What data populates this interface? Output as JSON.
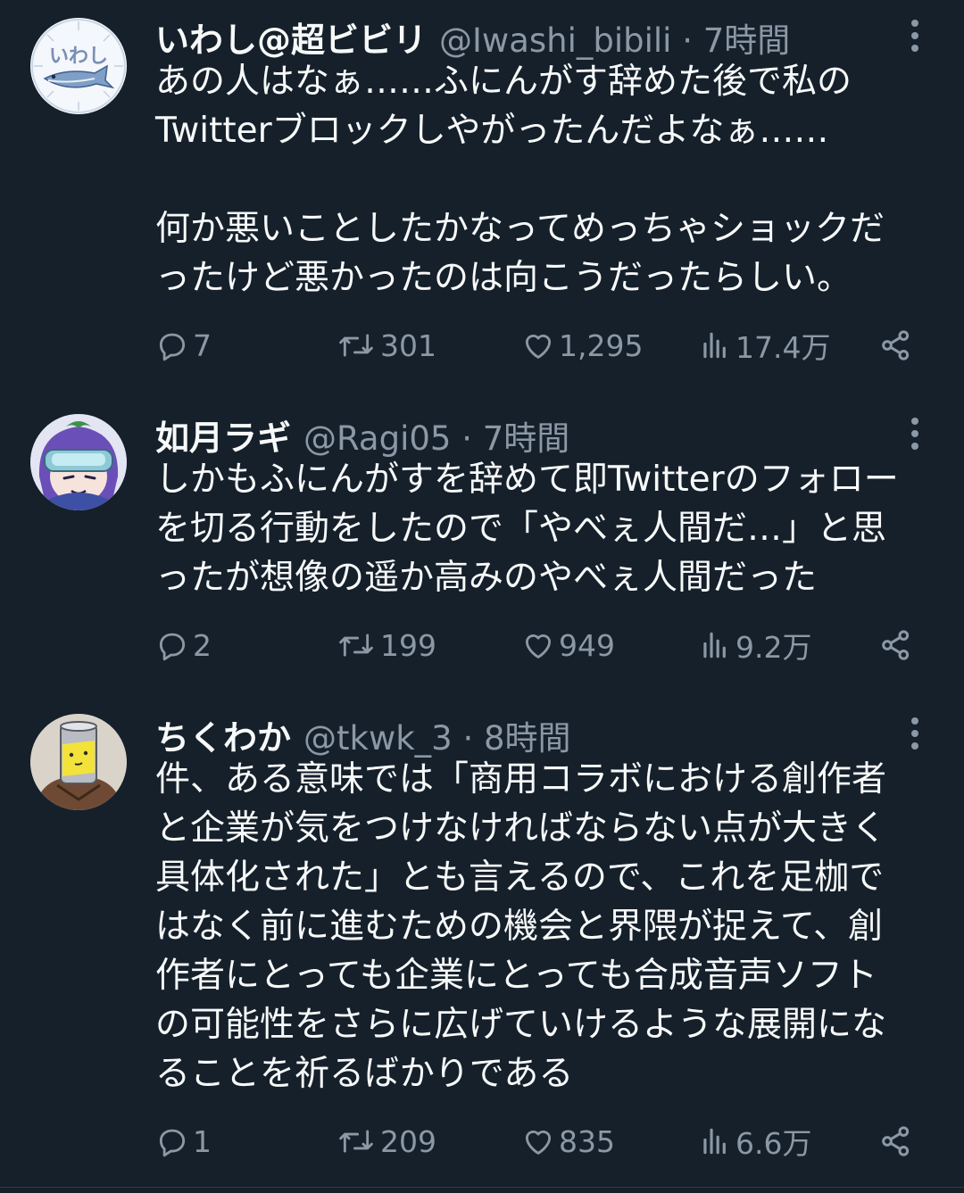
{
  "colors": {
    "background": "#15202b",
    "text_primary": "#f7f9f9",
    "text_secondary": "#8b98a5"
  },
  "tweets": [
    {
      "display_name": "いわし@超ビビリ",
      "meta": "@Iwashi_bibili · 7時間",
      "avatar_text": "いわし",
      "avatar_icon": "sardine-fish-icon",
      "body": "あの人はなぁ……ふにんがす辞めた後で私の\nTwitterブロックしやがったんだよなぁ……\n\n何か悪いことしたかなってめっちゃショックだ\nったけど悪かったのは向こうだったらしい。",
      "replies": "7",
      "retweets": "301",
      "likes": "1,295",
      "views": "17.4万"
    },
    {
      "display_name": "如月ラギ",
      "meta": "@Ragi05 · 7時間",
      "avatar_icon": "anime-character-avatar-icon",
      "body": "しかもふにんがすを辞めて即Twitterのフォロー\nを切る行動をしたので「やべぇ人間だ…」と思\nったが想像の遥か高みのやべぇ人間だった",
      "replies": "2",
      "retweets": "199",
      "likes": "949",
      "views": "9.2万"
    },
    {
      "display_name": "ちくわか",
      "meta": "@tkwk_3 · 8時間",
      "avatar_icon": "can-head-avatar-icon",
      "body": "件、ある意味では「商用コラボにおける創作者\nと企業が気をつけなければならない点が大きく\n具体化された」とも言えるので、これを足枷で\nはなく前に進むための機会と界隈が捉えて、創\n作者にとっても企業にとっても合成音声ソフト\nの可能性をさらに広げていけるような展開にな\nることを祈るばかりである",
      "replies": "1",
      "retweets": "209",
      "likes": "835",
      "views": "6.6万"
    }
  ]
}
